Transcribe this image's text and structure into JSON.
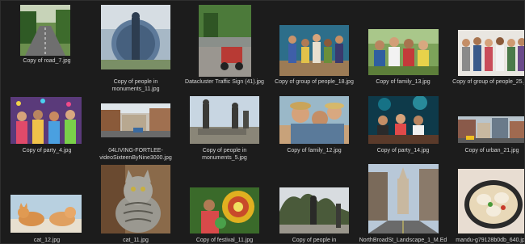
{
  "files": [
    {
      "name": "Copy of road_7.jpg",
      "thumb_icon": "road-photo-icon"
    },
    {
      "name": "Copy of people in monuments_11.jpg",
      "thumb_icon": "monument-statue-photo-icon"
    },
    {
      "name": "Datacluster Traffic Sign (41).jpg",
      "thumb_icon": "street-motorbike-photo-icon"
    },
    {
      "name": "Copy of group of people_18.jpg",
      "thumb_icon": "group-people-photo-icon"
    },
    {
      "name": "Copy of family_13.jpg",
      "thumb_icon": "family-photo-icon"
    },
    {
      "name": "Copy of group of people_25.jpg",
      "thumb_icon": "group-people-photo-icon"
    },
    {
      "name": "Copy of party_4.jpg",
      "thumb_icon": "party-photo-icon"
    },
    {
      "name": "04LIVING-FORTLEE-videoSixteenByNine3000.jpg",
      "thumb_icon": "street-town-photo-icon"
    },
    {
      "name": "Copy of people in monuments_5.jpg",
      "thumb_icon": "monument-statue-photo-icon"
    },
    {
      "name": "Copy of family_12.jpg",
      "thumb_icon": "family-photo-icon"
    },
    {
      "name": "Copy of party_14.jpg",
      "thumb_icon": "party-photo-icon"
    },
    {
      "name": "Copy of urban_21.jpg",
      "thumb_icon": "urban-street-photo-icon"
    },
    {
      "name": "cat_12.jpg",
      "thumb_icon": "cats-photo-icon"
    },
    {
      "name": "cat_11.jpg",
      "thumb_icon": "cat-photo-icon"
    },
    {
      "name": "Copy of festival_11.jpg",
      "thumb_icon": "festival-photo-icon"
    },
    {
      "name": "Copy of people in",
      "thumb_icon": "monument-statue-photo-icon"
    },
    {
      "name": "NorthBroadSt_Landscape_1_M.Ed",
      "thumb_icon": "city-street-photo-icon"
    },
    {
      "name": "mandu-g79128b0db_640.jpg",
      "thumb_icon": "dumplings-photo-icon"
    }
  ]
}
